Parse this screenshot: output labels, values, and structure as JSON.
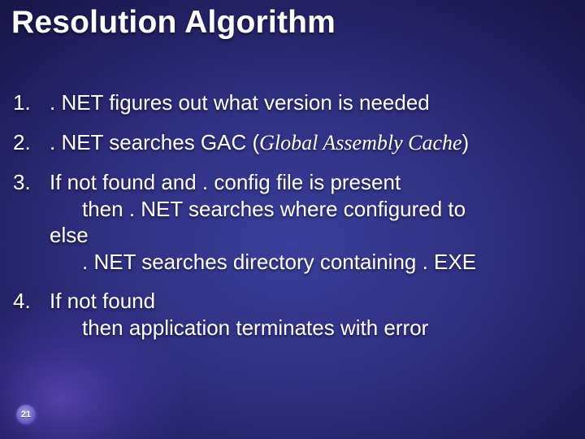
{
  "title": "Resolution Algorithm",
  "items": [
    {
      "num": "1.",
      "text": ". NET figures out what version is needed"
    },
    {
      "num": "2.",
      "prefix": ". NET searches GAC (",
      "ital": "Global Assembly Cache",
      "suffix": ")"
    },
    {
      "num": "3.",
      "l1": "If not found and . config file is present",
      "l2": "then . NET searches where configured to",
      "l3": "else",
      "l4": ". NET searches directory containing . EXE"
    },
    {
      "num": "4.",
      "l1": "If not found",
      "l2": "then application terminates with error"
    }
  ],
  "page_number": "21"
}
